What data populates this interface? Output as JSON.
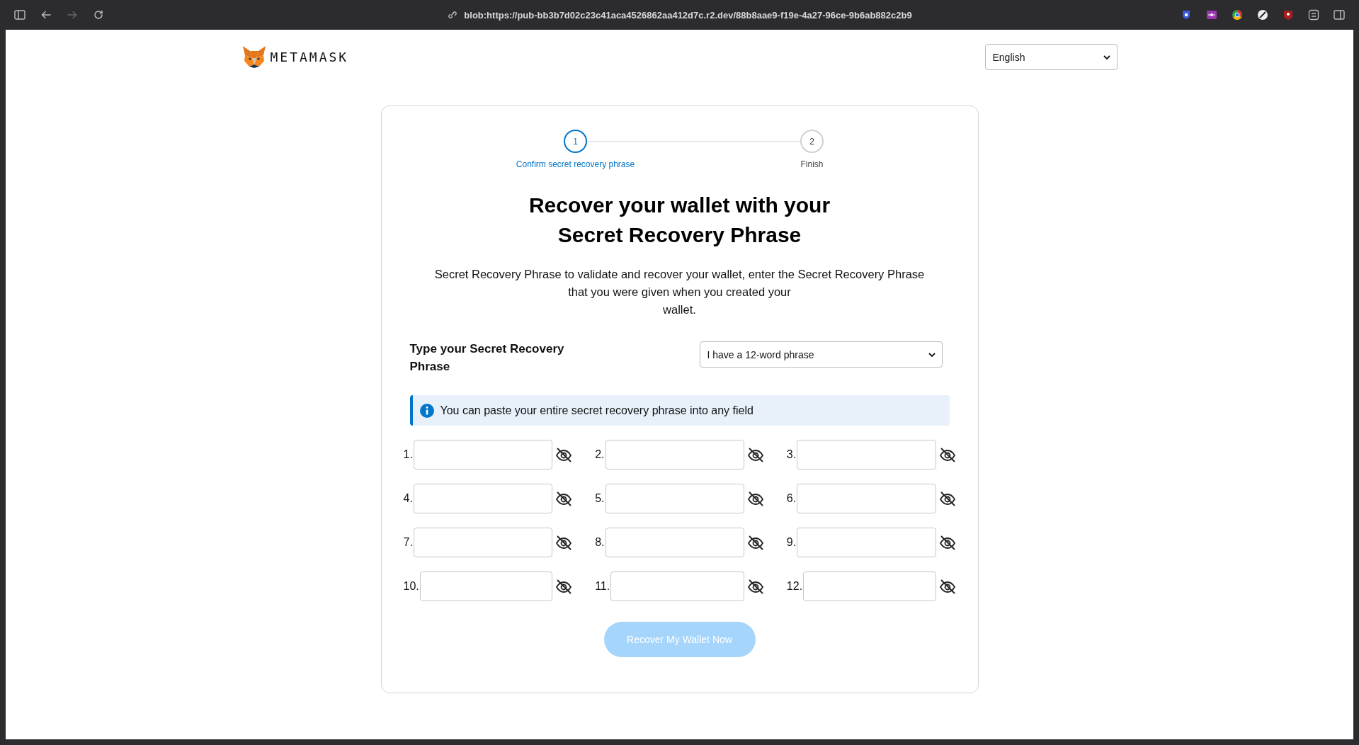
{
  "browser": {
    "url": "blob:https://pub-bb3b7d02c23c41aca4526862aa412d7c.r2.dev/88b8aae9-f19e-4a27-96ce-9b6ab882c2b9",
    "nav_buttons": [
      {
        "kind": "back",
        "disabled": false
      },
      {
        "kind": "forward",
        "disabled": true
      },
      {
        "kind": "reload",
        "disabled": false
      }
    ]
  },
  "header": {
    "logo_text": "METAMASK",
    "language": "English"
  },
  "stepper": [
    {
      "number": "1",
      "label": "Confirm secret recovery phrase",
      "selected": true
    },
    {
      "number": "2",
      "label": "Finish",
      "selected": false
    }
  ],
  "title_lines": [
    "Recover your wallet with your",
    "Secret Recovery Phrase"
  ],
  "description_lines": [
    "Secret Recovery Phrase to validate and recover your wallet, enter the Secret Recovery Phrase",
    "that you were given when you created your",
    "wallet."
  ],
  "phrase_label": "Type your Secret Recovery Phrase",
  "phrase_length": "I have a 12-word phrase",
  "info": "You can paste your entire secret recovery phrase into any field",
  "words": [
    {
      "number": "1."
    },
    {
      "number": "2."
    },
    {
      "number": "3."
    },
    {
      "number": "4."
    },
    {
      "number": "5."
    },
    {
      "number": "6."
    },
    {
      "number": "7."
    },
    {
      "number": "8."
    },
    {
      "number": "9."
    },
    {
      "number": "10."
    },
    {
      "number": "11."
    },
    {
      "number": "12."
    }
  ],
  "submit": {
    "label": "Recover My Wallet Now",
    "disabled": true
  }
}
